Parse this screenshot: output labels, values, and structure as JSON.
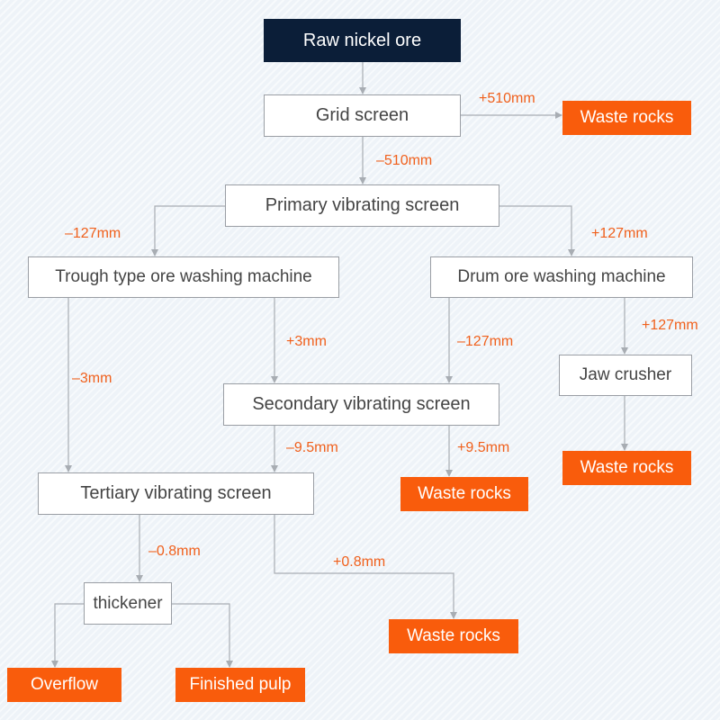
{
  "colors": {
    "start": "#0b1e38",
    "output": "#f95c0c",
    "label": "#f0601c",
    "line": "#a8adb3",
    "background": "#eef3f8"
  },
  "nodes": {
    "raw": "Raw nickel ore",
    "grid": "Grid screen",
    "primary": "Primary vibrating screen",
    "trough": "Trough type ore washing machine",
    "drum": "Drum ore washing machine",
    "jaw": "Jaw crusher",
    "secondary": "Secondary vibrating screen",
    "tertiary": "Tertiary vibrating screen",
    "thickener": "thickener",
    "waste1": "Waste rocks",
    "waste2": "Waste rocks",
    "waste3": "Waste rocks",
    "waste4": "Waste rocks",
    "overflow": "Overflow",
    "pulp": "Finished pulp"
  },
  "edges": {
    "grid_plus": "+510mm",
    "grid_minus": "–510mm",
    "primary_minus": "–127mm",
    "primary_plus": "+127mm",
    "drum_plus": "+127mm",
    "trough_plus": "+3mm",
    "drum_minus": "–127mm",
    "trough_minus": "–3mm",
    "secondary_minus": "–9.5mm",
    "secondary_plus": "+9.5mm",
    "tertiary_minus": "–0.8mm",
    "tertiary_plus": "+0.8mm"
  }
}
